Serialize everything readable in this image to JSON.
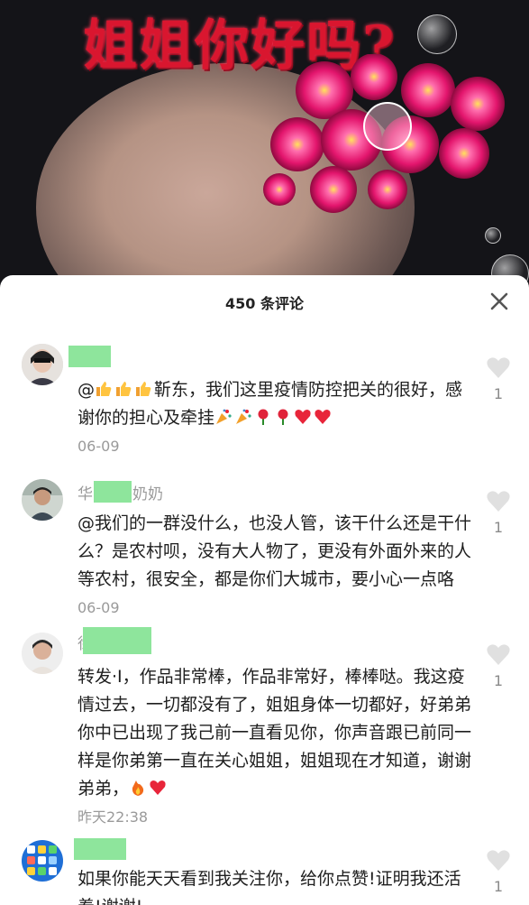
{
  "video": {
    "overlay_title": "姐姐你好吗?"
  },
  "sheet": {
    "count_label": "450 条评论"
  },
  "comments": [
    {
      "name_visible": "",
      "text_prefix": "@",
      "text_main": "靳东，我们这里疫情防控把关的很好，感谢你的担心及牵挂",
      "time": "06-09",
      "likes": "1"
    },
    {
      "name_visible_left": "华",
      "name_visible_right": "奶奶",
      "text_main": "@我们的一群没什么，也没人管，该干什么还是干什么？是农村呗，没有大人物了，更没有外面外来的人等农村，很安全，都是你们大城市，要小心一点咯",
      "time": "06-09",
      "likes": "1"
    },
    {
      "name_visible_left": "徐",
      "text_main": "转发·I，作品非常棒，作品非常好，棒棒哒。我这疫情过去，一切都没有了，姐姐身体一切都好，好弟弟你中已出现了我己前一直看见你，你声音跟已前同一样是你弟第一直在关心姐姐，姐姐现在才知道，谢谢弟弟，",
      "time": "昨天22:38",
      "likes": "1"
    },
    {
      "text_main": "如果你能天天看到我关注你，给你点赞!证明我还活着!谢谢!",
      "likes": "1"
    }
  ],
  "icons": {
    "like": "heart-outline-icon",
    "close": "close-x-icon",
    "thumbs": "thumbs-up-emoji",
    "party": "party-popper-emoji",
    "rose": "rose-emoji",
    "heart": "red-heart-emoji",
    "fire": "fire-emoji"
  },
  "colors": {
    "name_mask": "#8ee59c",
    "title_red": "#d9162f",
    "heart_red": "#e8253a"
  }
}
